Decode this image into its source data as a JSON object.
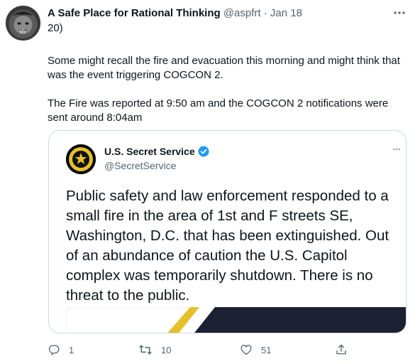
{
  "tweet": {
    "author_name": "A Safe Place for Rational Thinking",
    "handle": "@aspfrt",
    "separator": "·",
    "date": "Jan 18",
    "more_icon": "more-dots-icon",
    "paragraphs": [
      "20)",
      "Some might recall the fire and evacuation this morning and might think that was the event triggering COGCON 2.",
      "The Fire was reported at 9:50 am and the COGCON 2 notifications were sent around 8:04am"
    ]
  },
  "quoted": {
    "author_name": "U.S. Secret Service",
    "handle": "@SecretService",
    "verified_icon": "verified-badge-icon",
    "text": "Public safety and law enforcement responded to a small fire in the area of 1st and F streets SE, Washington, D.C. that has been extinguished. Out of an abundance of caution the U.S. Capitol complex was temporarily shutdown. There is no threat to the public."
  },
  "actions": {
    "reply_count": "1",
    "retweet_count": "10",
    "like_count": "51"
  },
  "colors": {
    "text_primary": "#0f1419",
    "text_secondary": "#536471",
    "border": "#cfd9de",
    "verified_blue": "#1d9bf0",
    "banner_navy": "#1c2033",
    "banner_gold": "#e6c028"
  }
}
